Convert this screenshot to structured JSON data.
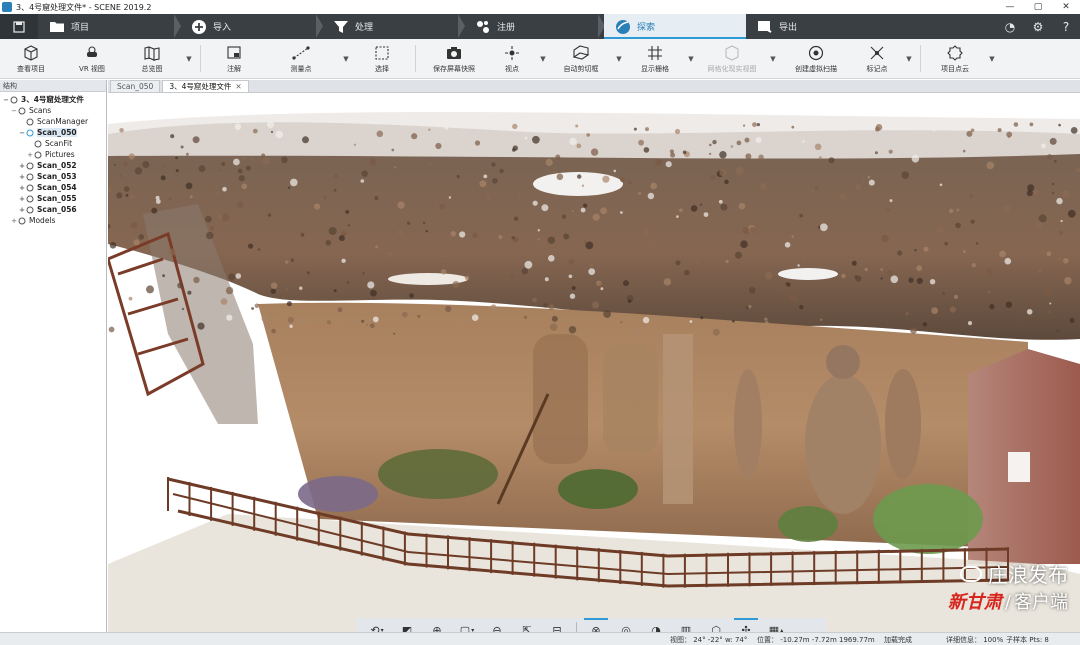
{
  "window": {
    "title": "3、4号窟处理文件* - SCENE 2019.2",
    "controls": [
      "—",
      "▢",
      "✕"
    ]
  },
  "workflow_tabs": [
    {
      "label": "项目",
      "icon": "folder-icon"
    },
    {
      "label": "导入",
      "icon": "import-plus-icon"
    },
    {
      "label": "处理",
      "icon": "funnel-icon"
    },
    {
      "label": "注册",
      "icon": "registration-icon"
    },
    {
      "label": "探索",
      "icon": "explore-globe-icon",
      "active": true
    },
    {
      "label": "导出",
      "icon": "export-icon"
    }
  ],
  "ribbon": {
    "buttons": [
      {
        "label": "查看项目",
        "icon": "cube-icon"
      },
      {
        "label": "VR 视图",
        "icon": "vr-headset-icon"
      },
      {
        "label": "总览图",
        "icon": "map-overview-icon",
        "dropdown": true
      },
      {
        "label": "注解",
        "icon": "annotation-icon"
      },
      {
        "label": "测量点",
        "icon": "measure-points-icon",
        "dropdown": true
      },
      {
        "label": "选择",
        "icon": "select-icon"
      },
      {
        "label": "保存屏幕快照",
        "icon": "camera-icon"
      },
      {
        "label": "视点",
        "icon": "viewpoint-icon",
        "dropdown": true
      },
      {
        "label": "自动剪切框",
        "icon": "clipping-box-icon",
        "dropdown": true
      },
      {
        "label": "显示栅格",
        "icon": "grid-icon",
        "dropdown": true
      },
      {
        "label": "网格化现实视图",
        "icon": "mesh-icon",
        "disabled": true,
        "dropdown": true
      },
      {
        "label": "创建虚拟扫描",
        "icon": "virtual-scan-icon"
      },
      {
        "label": "标记点",
        "icon": "marker-icon",
        "dropdown": true
      },
      {
        "label": "项目点云",
        "icon": "project-pointcloud-icon",
        "dropdown": true
      }
    ]
  },
  "sidebar": {
    "header": "结构",
    "tree": [
      {
        "label": "3、4号窟处理文件",
        "level": 0,
        "bold": true,
        "expander": "−",
        "icon": "project-icon"
      },
      {
        "label": "Scans",
        "level": 1,
        "expander": "−",
        "icon": "scans-folder-icon"
      },
      {
        "label": "ScanManager",
        "level": 2,
        "expander": "",
        "icon": "scanmanager-icon"
      },
      {
        "label": "Scan_050",
        "level": 2,
        "bold": true,
        "expander": "−",
        "icon": "scan-icon",
        "selected": true
      },
      {
        "label": "ScanFit",
        "level": 3,
        "expander": "",
        "icon": "scanfit-icon"
      },
      {
        "label": "Pictures",
        "level": 3,
        "expander": "+",
        "icon": "pictures-icon"
      },
      {
        "label": "Scan_052",
        "level": 2,
        "bold": true,
        "expander": "+",
        "icon": "scan-icon"
      },
      {
        "label": "Scan_053",
        "level": 2,
        "bold": true,
        "expander": "+",
        "icon": "scan-icon"
      },
      {
        "label": "Scan_054",
        "level": 2,
        "bold": true,
        "expander": "+",
        "icon": "scan-icon"
      },
      {
        "label": "Scan_055",
        "level": 2,
        "bold": true,
        "expander": "+",
        "icon": "scan-icon"
      },
      {
        "label": "Scan_056",
        "level": 2,
        "bold": true,
        "expander": "+",
        "icon": "scan-icon"
      },
      {
        "label": "Models",
        "level": 1,
        "expander": "+",
        "icon": "models-icon"
      }
    ]
  },
  "doc_tabs": [
    {
      "label": "Scan_050",
      "active": false
    },
    {
      "label": "3、4号窟处理文件",
      "active": true
    }
  ],
  "view_toolbar": [
    {
      "icon": "orbit-navigation-icon",
      "dropdown": true
    },
    {
      "icon": "view-front-icon"
    },
    {
      "icon": "zoom-icon"
    },
    {
      "icon": "projection-cube-icon",
      "dropdown": true
    },
    {
      "icon": "rotate-view-icon"
    },
    {
      "icon": "walk-mode-icon"
    },
    {
      "icon": "clipping-plane-icon"
    },
    {
      "icon": "point-size-icon",
      "active": true
    },
    {
      "icon": "filter-icon"
    },
    {
      "icon": "slice-icon"
    },
    {
      "icon": "section-icon"
    },
    {
      "icon": "box-icon"
    },
    {
      "icon": "fit-view-icon",
      "active": true
    },
    {
      "icon": "grid-display-icon",
      "dropdown": true
    }
  ],
  "watermark": {
    "line1": "庄浪发布",
    "brand": "新甘肃",
    "slash": "/",
    "line2": "客户端"
  },
  "statusbar": {
    "view": "视图： 24° -22° w: 74°",
    "position": "位置： -10.27m -7.72m 1969.77m",
    "load": "加载完成",
    "detail": "详细信息： 100%",
    "subsample": "子样本 Pts: 8"
  },
  "colors": {
    "workflow_bg": "#3a3f44",
    "active_tab_bg": "#e6eef4",
    "accent": "#2f9bd6",
    "ribbon_bg": "#f1f3f5",
    "rock": "#9a6f4d",
    "fence": "#6e3b26"
  }
}
